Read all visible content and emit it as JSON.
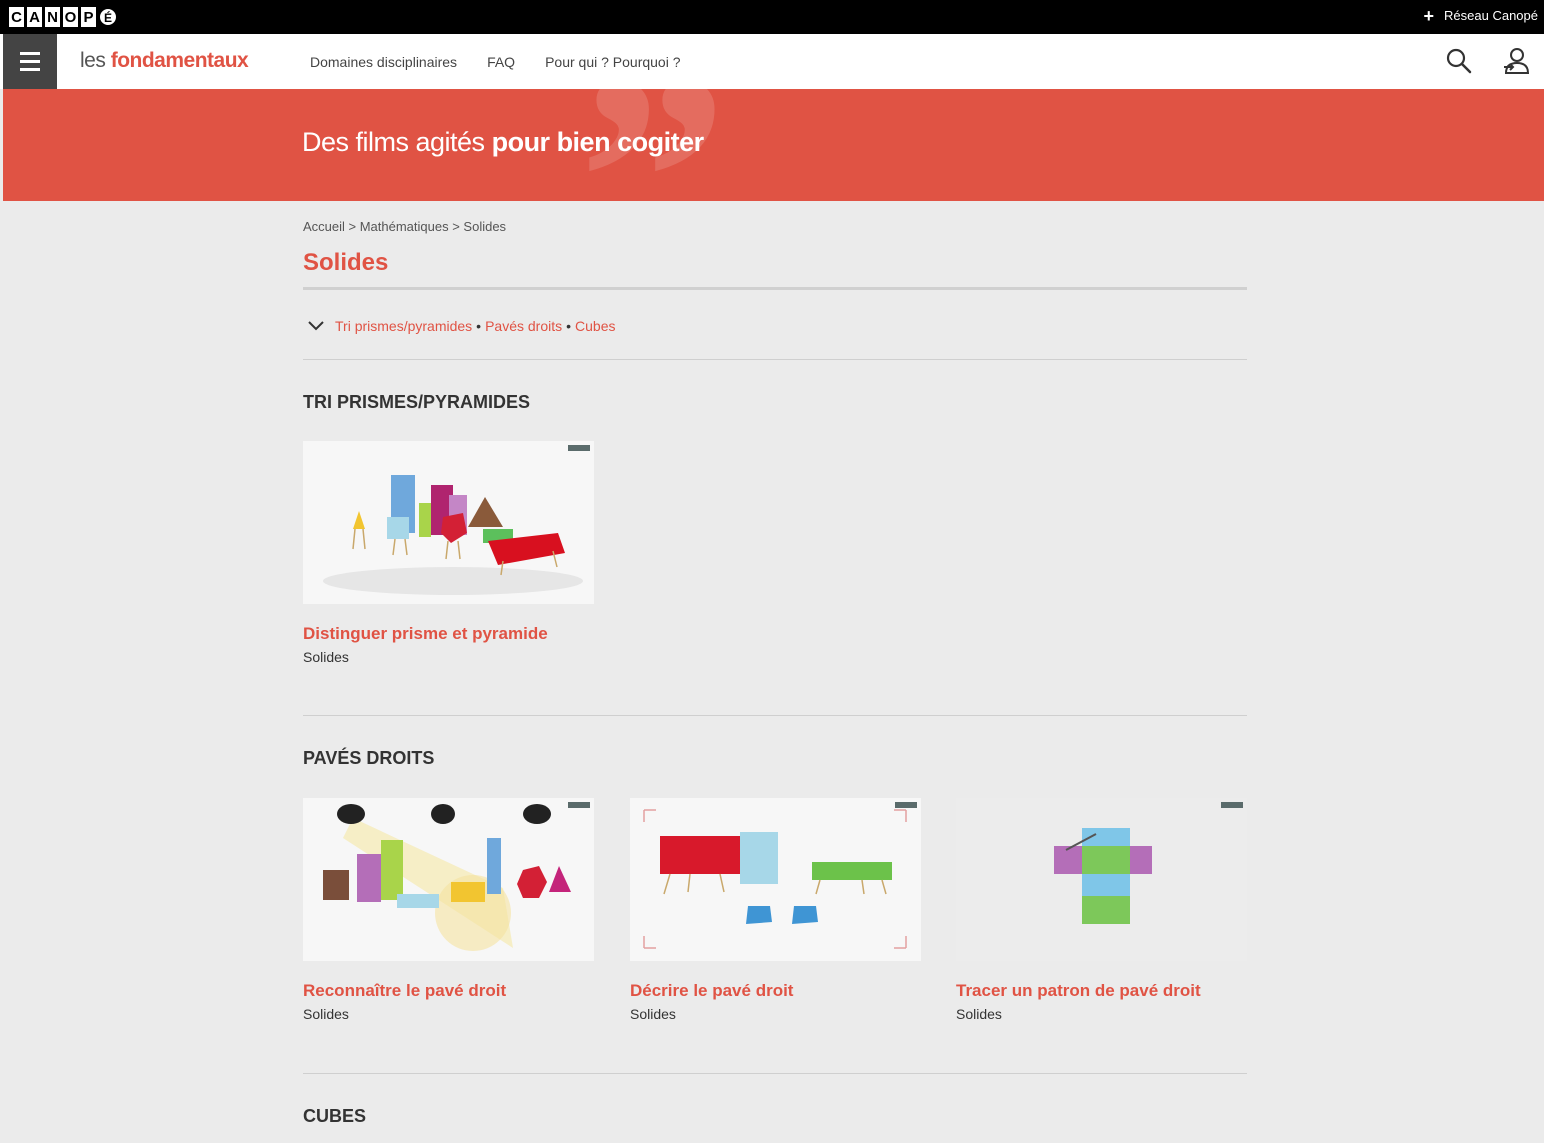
{
  "topbar": {
    "logo_letters": [
      "C",
      "A",
      "N",
      "O",
      "P",
      "É"
    ],
    "reseau_label": "Réseau Canopé"
  },
  "header": {
    "brand_les": "les",
    "brand_fond": "fondamentaux",
    "nav": [
      "Domaines disciplinaires",
      "FAQ",
      "Pour qui ? Pourquoi ?"
    ],
    "icons": [
      "menu-icon",
      "search-icon",
      "user-login-icon"
    ]
  },
  "banner": {
    "tagline_light": "Des films agités",
    "tagline_bold": "pour bien cogiter"
  },
  "breadcrumb": "Accueil > Mathématiques > Solides",
  "page_title": "Solides",
  "toc": [
    "Tri prismes/pyramides",
    "Pavés droits",
    "Cubes"
  ],
  "sections": [
    {
      "title": "TRI PRISMES/PYRAMIDES",
      "cards": [
        {
          "title": "Distinguer prisme et pyramide",
          "subtitle": "Solides"
        }
      ]
    },
    {
      "title": "PAVÉS DROITS",
      "cards": [
        {
          "title": "Reconnaître le pavé droit",
          "subtitle": "Solides"
        },
        {
          "title": "Décrire le pavé droit",
          "subtitle": "Solides"
        },
        {
          "title": "Tracer un patron de pavé droit",
          "subtitle": "Solides"
        }
      ]
    },
    {
      "title": "CUBES",
      "cards": []
    }
  ],
  "colors": {
    "accent": "#e05344",
    "background": "#ebebeb",
    "topbar": "#000000",
    "burger": "#444444"
  }
}
